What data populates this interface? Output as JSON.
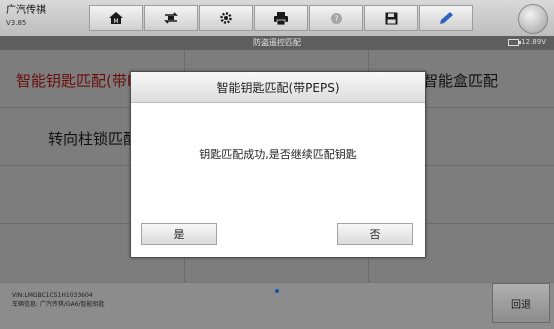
{
  "app": {
    "title": "广汽传祺",
    "version": "V3.85"
  },
  "toolbar": {
    "icons": [
      "home-icon",
      "vehicle-swap-icon",
      "settings-gear-icon",
      "printer-icon",
      "help-icon",
      "save-floppy-icon",
      "pen-edit-icon"
    ]
  },
  "header": {
    "title": "防盗遥控匹配",
    "battery": "12.89V"
  },
  "menu": {
    "items": [
      {
        "label": "智能钥匙匹配(带PEPS)"
      },
      {
        "label": "智能盒匹配"
      },
      {
        "label": "转向柱锁匹配"
      }
    ]
  },
  "dialog": {
    "title": "智能钥匙匹配(带PEPS)",
    "message": "钥匙匹配成功,是否继续匹配钥匙",
    "yes_label": "是",
    "no_label": "否"
  },
  "footer": {
    "vin": "VIN:LMGBC1C51H1033604",
    "vehicle_info": "车辆信息: 广汽传祺/GA6/智能钥匙",
    "back_label": "回退"
  },
  "colors": {
    "accent_text": "#7a1010",
    "page_indicator": "#1a4fb8"
  }
}
